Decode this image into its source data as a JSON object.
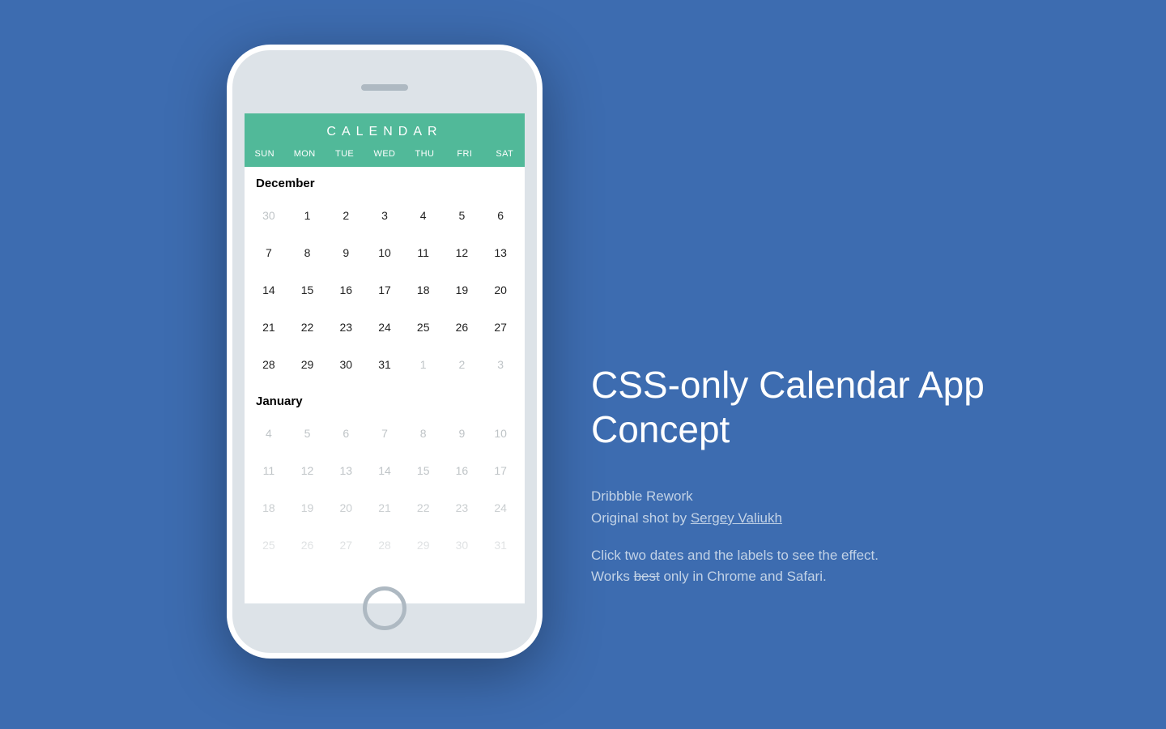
{
  "calendar": {
    "title": "CALENDAR",
    "dow": [
      "SUN",
      "MON",
      "TUE",
      "WED",
      "THU",
      "FRI",
      "SAT"
    ],
    "months": [
      {
        "name": "December",
        "cells": [
          {
            "n": "30",
            "muted": true
          },
          {
            "n": "1"
          },
          {
            "n": "2"
          },
          {
            "n": "3"
          },
          {
            "n": "4"
          },
          {
            "n": "5"
          },
          {
            "n": "6"
          },
          {
            "n": "7"
          },
          {
            "n": "8"
          },
          {
            "n": "9"
          },
          {
            "n": "10"
          },
          {
            "n": "11"
          },
          {
            "n": "12"
          },
          {
            "n": "13"
          },
          {
            "n": "14"
          },
          {
            "n": "15"
          },
          {
            "n": "16"
          },
          {
            "n": "17"
          },
          {
            "n": "18"
          },
          {
            "n": "19"
          },
          {
            "n": "20"
          },
          {
            "n": "21"
          },
          {
            "n": "22"
          },
          {
            "n": "23"
          },
          {
            "n": "24"
          },
          {
            "n": "25"
          },
          {
            "n": "26"
          },
          {
            "n": "27"
          },
          {
            "n": "28"
          },
          {
            "n": "29"
          },
          {
            "n": "30"
          },
          {
            "n": "31"
          },
          {
            "n": "1",
            "muted": true
          },
          {
            "n": "2",
            "muted": true
          },
          {
            "n": "3",
            "muted": true
          }
        ]
      },
      {
        "name": "January",
        "cells": [
          {
            "n": "4",
            "muted": true
          },
          {
            "n": "5",
            "muted": true
          },
          {
            "n": "6",
            "muted": true
          },
          {
            "n": "7",
            "muted": true
          },
          {
            "n": "8",
            "muted": true
          },
          {
            "n": "9",
            "muted": true
          },
          {
            "n": "10",
            "muted": true
          },
          {
            "n": "11",
            "muted": true
          },
          {
            "n": "12",
            "muted": true
          },
          {
            "n": "13",
            "muted": true
          },
          {
            "n": "14",
            "muted": true
          },
          {
            "n": "15",
            "muted": true
          },
          {
            "n": "16",
            "muted": true
          },
          {
            "n": "17",
            "muted": true
          },
          {
            "n": "18",
            "muted": true
          },
          {
            "n": "19",
            "muted": true
          },
          {
            "n": "20",
            "muted": true
          },
          {
            "n": "21",
            "muted": true
          },
          {
            "n": "22",
            "muted": true
          },
          {
            "n": "23",
            "muted": true
          },
          {
            "n": "24",
            "muted": true
          },
          {
            "n": "25",
            "muted": true
          },
          {
            "n": "26",
            "muted": true
          },
          {
            "n": "27",
            "muted": true
          },
          {
            "n": "28",
            "muted": true
          },
          {
            "n": "29",
            "muted": true
          },
          {
            "n": "30",
            "muted": true
          },
          {
            "n": "31",
            "muted": true
          }
        ]
      }
    ]
  },
  "info": {
    "title": "CSS-only Calendar App Concept",
    "line1a": "Dribbble Rework",
    "line1b_pre": "Original shot by ",
    "line1b_link": "Sergey Valiukh",
    "line2a": "Click two dates and the labels to see the effect.",
    "line2b_pre": "Works ",
    "line2b_strike": "best",
    "line2b_post": " only in Chrome and Safari."
  }
}
